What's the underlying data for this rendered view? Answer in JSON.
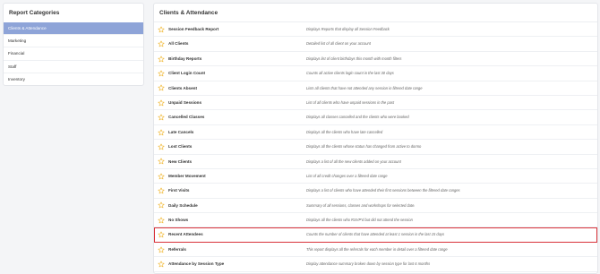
{
  "sidebar": {
    "title": "Report Categories",
    "items": [
      {
        "label": "Clients & Attendance",
        "active": true
      },
      {
        "label": "Marketing",
        "active": false
      },
      {
        "label": "Financial",
        "active": false
      },
      {
        "label": "Staff",
        "active": false
      },
      {
        "label": "Inventory",
        "active": false
      }
    ]
  },
  "main": {
    "title": "Clients & Attendance",
    "star_color": "#f0b429",
    "highlight_color": "#d9323a",
    "highlighted_report": "Recent Attendees",
    "reports": [
      {
        "name": "Session Feedback Report",
        "description": "Displays Reports that display all Session Feedback"
      },
      {
        "name": "All Clients",
        "description": "Detailed list of all client on your account"
      },
      {
        "name": "Birthday Reports",
        "description": "Displays list of client birthdays this month with month filters"
      },
      {
        "name": "Client Login Count",
        "description": "Counts all active clients login count in the last 30 days"
      },
      {
        "name": "Clients Absent",
        "description": "Lists all clients that have not attended any session in filtered date range"
      },
      {
        "name": "Unpaid Sessions",
        "description": "List of all clients who have unpaid sessions in the past"
      },
      {
        "name": "Cancelled Classes",
        "description": "Displays all classes cancelled and the clients who were booked"
      },
      {
        "name": "Late Cancels",
        "description": "Displays all the clients who have late cancelled"
      },
      {
        "name": "Lost Clients",
        "description": "Displays all the clients whose status has changed from active to dormo"
      },
      {
        "name": "New Clients",
        "description": "Displays a list of all the new clients added on your account"
      },
      {
        "name": "Member Movement",
        "description": "List of all credit changes over a filtered date range"
      },
      {
        "name": "First Visits",
        "description": "Displays a list of clients who have attended their first sessions between the filtered date ranges"
      },
      {
        "name": "Daily Schedule",
        "description": "Summary of all sessions, classes and workshops for selected date."
      },
      {
        "name": "No Shows",
        "description": "Displays all the clients who RSVP'd but did not attend the session"
      },
      {
        "name": "Recent Attendees",
        "description": "Counts the number of clients that have attended at least 1 session in the last 15 days"
      },
      {
        "name": "Referrals",
        "description": "This report displays all the referrals for each member in detail over a filtered date range"
      },
      {
        "name": "Attendance by Session Type",
        "description": "Display attendance summary broken down by session type for last 6 months"
      }
    ]
  }
}
